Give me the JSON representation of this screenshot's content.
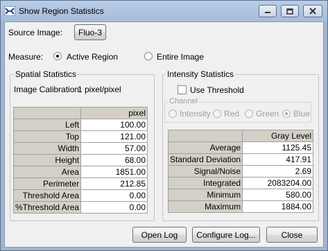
{
  "window": {
    "title": "Show Region Statistics",
    "minimize_icon": "minimize-icon",
    "maximize_icon": "maximize-icon",
    "close_icon": "close-icon"
  },
  "source": {
    "label": "Source Image:",
    "button": "Fluo-3"
  },
  "measure": {
    "label": "Measure:",
    "options": [
      "Active Region",
      "Entire Image"
    ],
    "selected": "Active Region"
  },
  "spatial": {
    "title": "Spatial Statistics",
    "calibration_label": "Image Calibration:",
    "calibration_value": "1 pixel/pixel",
    "column_header": "pixel",
    "rows": [
      {
        "label": "Left",
        "value": "100.00"
      },
      {
        "label": "Top",
        "value": "121.00"
      },
      {
        "label": "Width",
        "value": "57.00"
      },
      {
        "label": "Height",
        "value": "68.00"
      },
      {
        "label": "Area",
        "value": "1851.00"
      },
      {
        "label": "Perimeter",
        "value": "212.85"
      },
      {
        "label": "Threshold Area",
        "value": "0.00"
      },
      {
        "label": "%Threshold Area",
        "value": "0.00"
      }
    ]
  },
  "intensity": {
    "title": "Intensity Statistics",
    "use_threshold_label": "Use Threshold",
    "use_threshold_checked": false,
    "channel_label": "Channel",
    "channels": [
      "Intensity",
      "Red",
      "Green",
      "Blue"
    ],
    "channel_selected": "Blue",
    "column_header": "Gray Level",
    "rows": [
      {
        "label": "Average",
        "value": "1125.45"
      },
      {
        "label": "Standard Deviation",
        "value": "417.91"
      },
      {
        "label": "Signal/Noise",
        "value": "2.69"
      },
      {
        "label": "Integrated",
        "value": "2083204.00"
      },
      {
        "label": "Minimum",
        "value": "580.00"
      },
      {
        "label": "Maximum",
        "value": "1884.00"
      }
    ]
  },
  "footer": {
    "open_log": "Open Log",
    "configure_log": "Configure Log...",
    "close": "Close"
  }
}
